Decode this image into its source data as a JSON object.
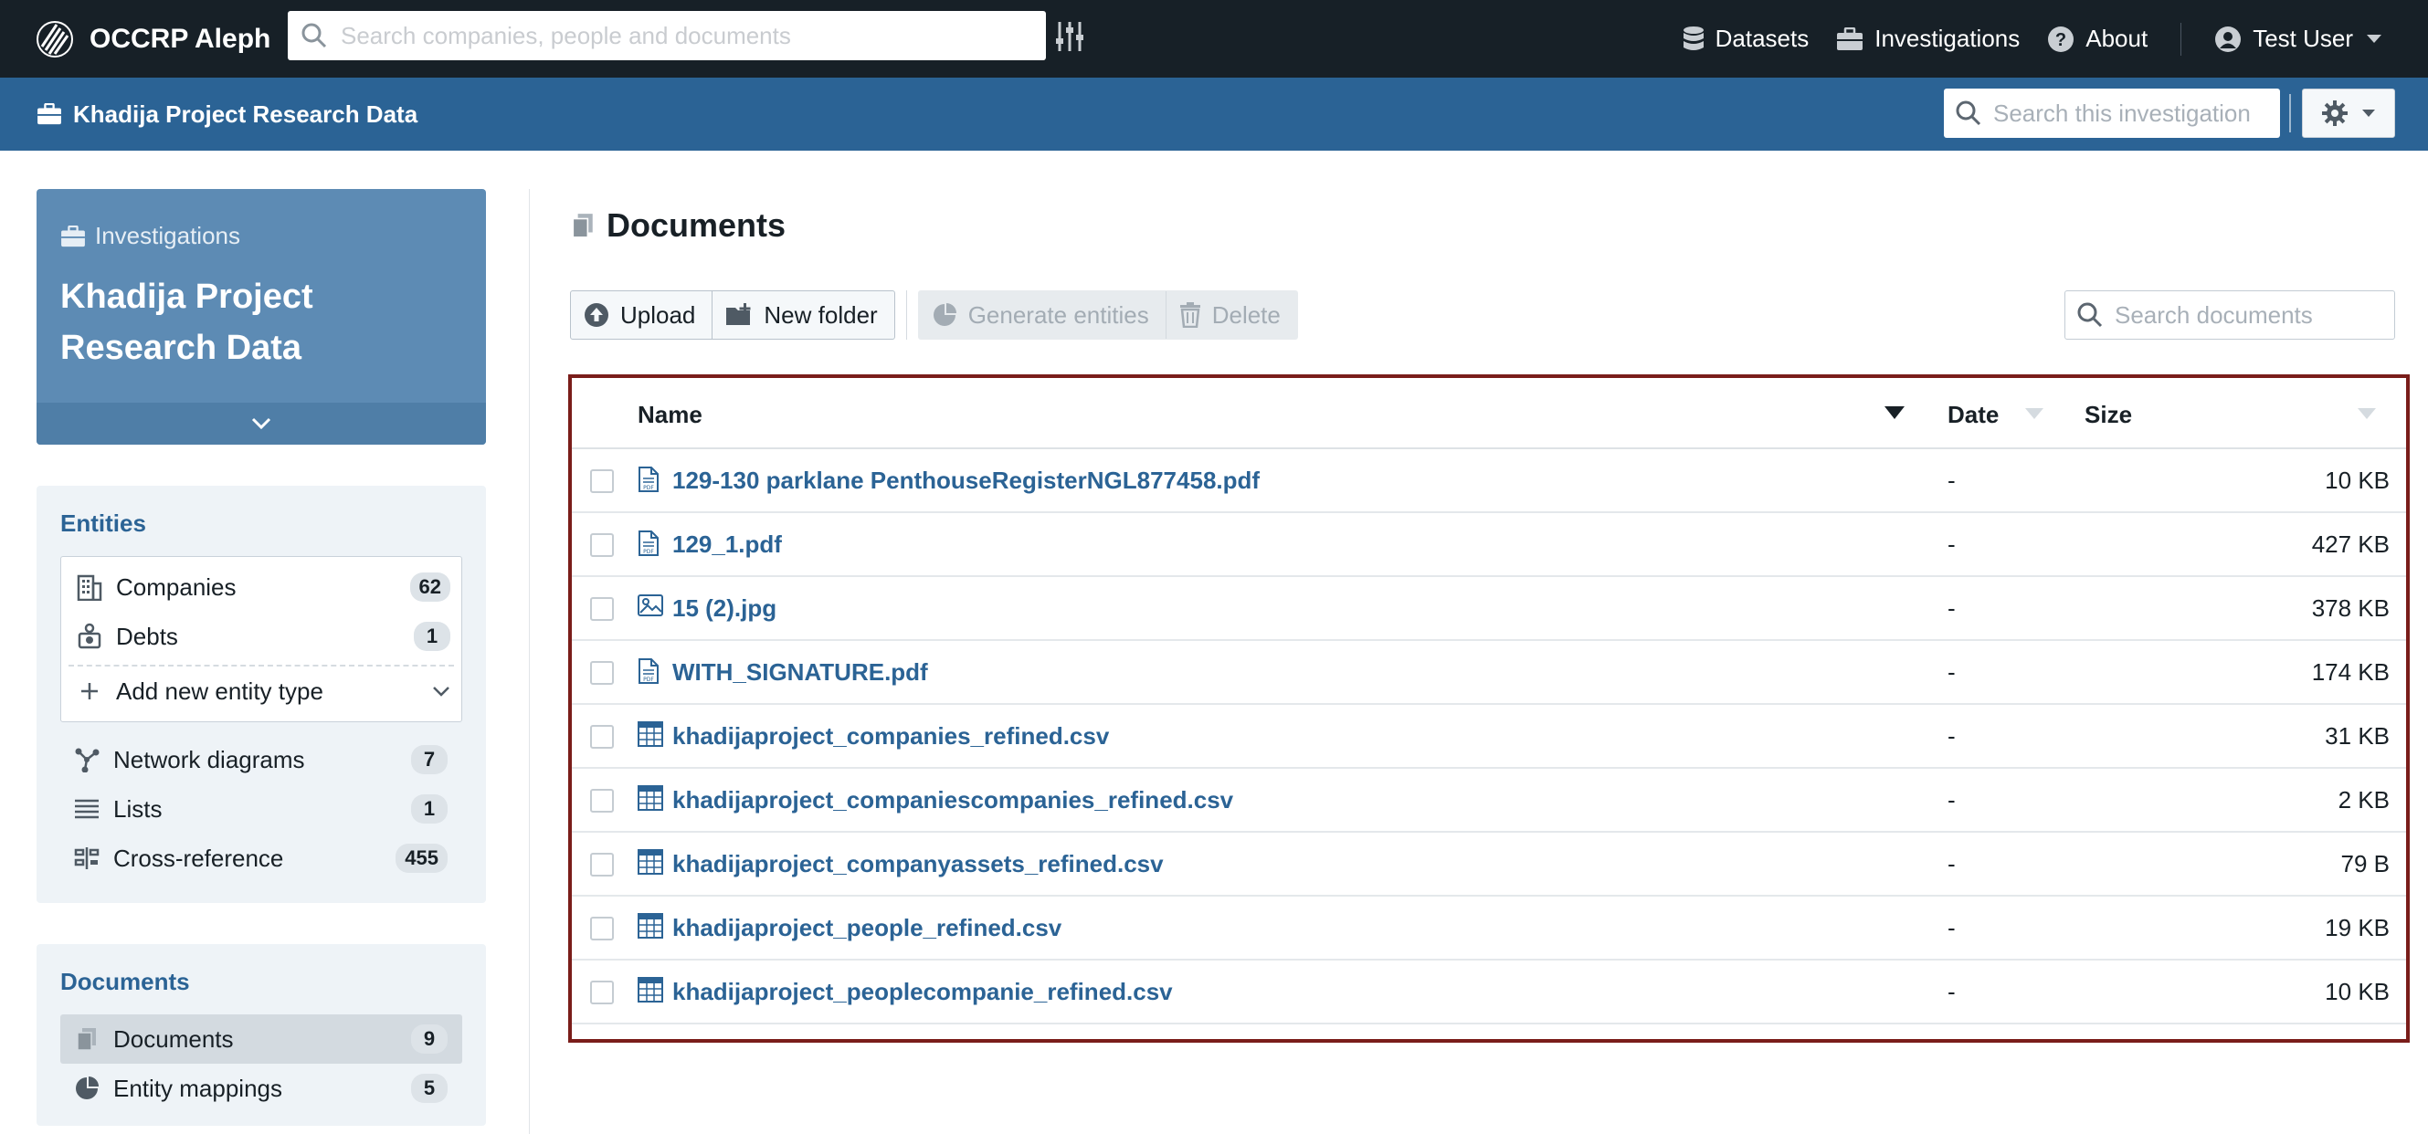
{
  "app": {
    "name": "OCCRP Aleph",
    "search_placeholder": "Search companies, people and documents"
  },
  "nav": {
    "datasets": "Datasets",
    "investigations": "Investigations",
    "about": "About",
    "user": "Test User"
  },
  "subbar": {
    "title": "Khadija Project Research Data",
    "search_placeholder": "Search this investigation"
  },
  "collection": {
    "category": "Investigations",
    "name": "Khadija Project Research Data"
  },
  "entities": {
    "title": "Entities",
    "schemata": [
      {
        "label": "Companies",
        "count": "62",
        "icon": "building-icon"
      },
      {
        "label": "Debts",
        "count": "1",
        "icon": "money-icon"
      }
    ],
    "add_label": "Add new entity type",
    "extra": [
      {
        "label": "Network diagrams",
        "count": "7",
        "icon": "graph-icon"
      },
      {
        "label": "Lists",
        "count": "1",
        "icon": "list-icon"
      },
      {
        "label": "Cross-reference",
        "count": "455",
        "icon": "comparison-icon"
      }
    ]
  },
  "documents_panel": {
    "title": "Documents",
    "items": [
      {
        "label": "Documents",
        "count": "9",
        "icon": "documents-icon"
      },
      {
        "label": "Entity mappings",
        "count": "5",
        "icon": "pie-icon"
      }
    ]
  },
  "main": {
    "title": "Documents",
    "toolbar": {
      "upload": "Upload",
      "new_folder": "New folder",
      "generate": "Generate entities",
      "delete": "Delete"
    },
    "search_placeholder": "Search documents",
    "columns": {
      "name": "Name",
      "date": "Date",
      "size": "Size"
    },
    "rows": [
      {
        "name": "129-130 parklane PenthouseRegisterNGL877458.pdf",
        "date": "-",
        "size": "10 KB",
        "icon": "pdf-icon"
      },
      {
        "name": "129_1.pdf",
        "date": "-",
        "size": "427 KB",
        "icon": "pdf-icon"
      },
      {
        "name": "15 (2).jpg",
        "date": "-",
        "size": "378 KB",
        "icon": "image-icon"
      },
      {
        "name": "WITH_SIGNATURE.pdf",
        "date": "-",
        "size": "174 KB",
        "icon": "pdf-icon"
      },
      {
        "name": "khadijaproject_companies_refined.csv",
        "date": "-",
        "size": "31 KB",
        "icon": "table-icon"
      },
      {
        "name": "khadijaproject_companiescompanies_refined.csv",
        "date": "-",
        "size": "2 KB",
        "icon": "table-icon"
      },
      {
        "name": "khadijaproject_companyassets_refined.csv",
        "date": "-",
        "size": "79 B",
        "icon": "table-icon"
      },
      {
        "name": "khadijaproject_people_refined.csv",
        "date": "-",
        "size": "19 KB",
        "icon": "table-icon"
      },
      {
        "name": "khadijaproject_peoplecompanie_refined.csv",
        "date": "-",
        "size": "10 KB",
        "icon": "table-icon"
      }
    ]
  },
  "colors": {
    "navbar": "#172027",
    "subbar": "#2b6395",
    "link": "#2b6395",
    "highlight_border": "#7a1d1a"
  }
}
